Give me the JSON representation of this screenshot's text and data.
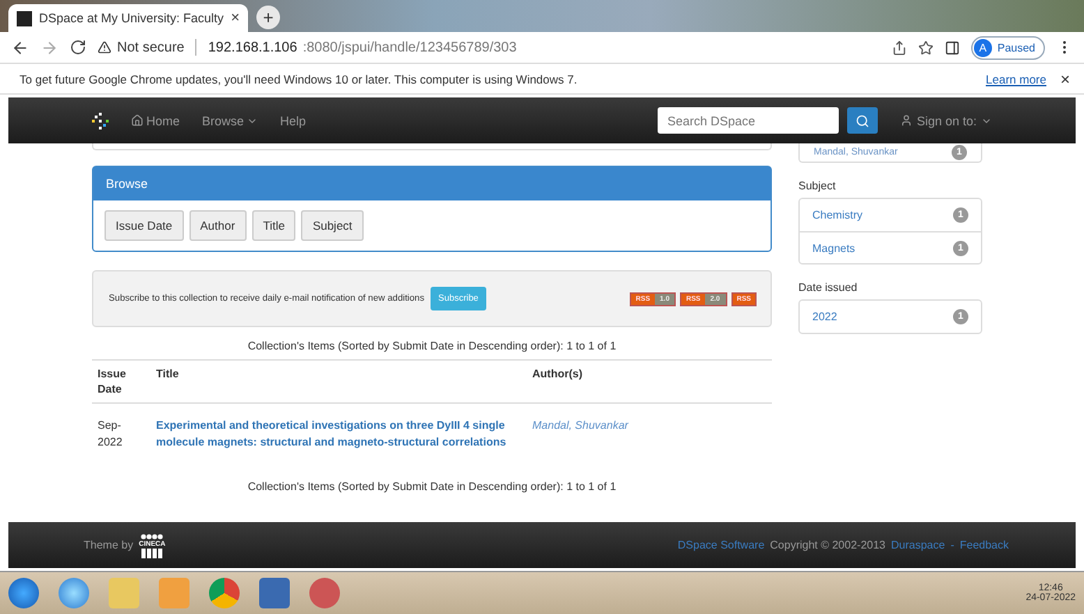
{
  "browser": {
    "tab_title": "DSpace at My University: Faculty",
    "tab_close": "×",
    "new_tab": "+",
    "security": "Not secure",
    "url_host": "192.168.1.106",
    "url_path": ":8080/jspui/handle/123456789/303",
    "profile_initial": "A",
    "profile_status": "Paused"
  },
  "infobar": {
    "message": "To get future Google Chrome updates, you'll need Windows 10 or later. This computer is using Windows 7.",
    "link": "Learn more",
    "close": "×"
  },
  "navbar": {
    "items": [
      {
        "label": "Home",
        "kind": "home"
      },
      {
        "label": "Browse",
        "kind": "dropdown"
      },
      {
        "label": "Help",
        "kind": "plain"
      }
    ],
    "search_placeholder": "Search DSpace",
    "sign_on": "Sign on to:"
  },
  "browse": {
    "title": "Browse",
    "buttons": [
      "Issue Date",
      "Author",
      "Title",
      "Subject"
    ]
  },
  "subscribe": {
    "text": "Subscribe to this collection to receive daily e-mail notification of new additions",
    "button": "Subscribe",
    "feeds": [
      {
        "label": "RSS",
        "version": "1.0"
      },
      {
        "label": "RSS",
        "version": "2.0"
      },
      {
        "label": "RSS"
      }
    ]
  },
  "listing": {
    "summary_top": "Collection's Items (Sorted by Submit Date in Descending order): 1 to 1 of 1",
    "columns": [
      "Issue Date",
      "Title",
      "Author(s)"
    ],
    "rows": [
      {
        "date": "Sep-2022",
        "title": "Experimental and theoretical investigations on three DyIII 4 single molecule magnets: structural and magneto-structural correlations",
        "author": "Mandal, Shuvankar"
      }
    ],
    "summary_bottom": "Collection's Items (Sorted by Submit Date in Descending order): 1 to 1 of 1"
  },
  "sidebar": {
    "cut_item": {
      "label": "Mandal, Shuvankar",
      "count": "1"
    },
    "facets": [
      {
        "heading": "Subject",
        "items": [
          {
            "label": "Chemistry",
            "count": "1"
          },
          {
            "label": "Magnets",
            "count": "1"
          }
        ]
      },
      {
        "heading": "Date issued",
        "items": [
          {
            "label": "2022",
            "count": "1"
          }
        ]
      }
    ]
  },
  "footer": {
    "theme_by": "Theme by",
    "logo_text": "CINECA",
    "software_link": "DSpace Software",
    "copyright": "Copyright © 2002-2013",
    "duraspace_link": "Duraspace",
    "separator": "-",
    "feedback_link": "Feedback"
  },
  "taskbar": {
    "time": "12:46",
    "date": "24-07-2022"
  }
}
